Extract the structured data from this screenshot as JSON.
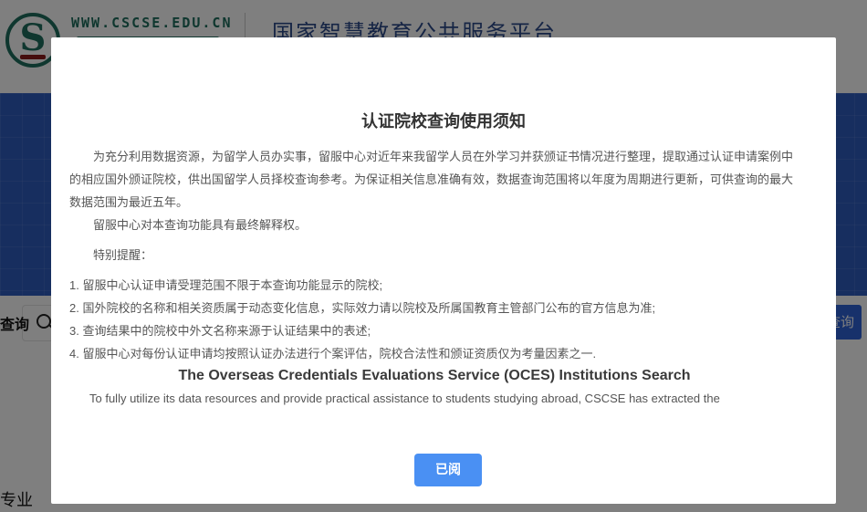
{
  "header": {
    "logo_url_text": "WWW.CSCSE.EDU.CN",
    "platform_title": "国家智慧教育公共服务平台"
  },
  "search": {
    "label": "查询",
    "button_label": "查询"
  },
  "background": {
    "bottom_label": "专业"
  },
  "modal": {
    "title": "认证院校查询使用须知",
    "paragraphs": [
      "为充分利用数据资源，为留学人员办实事，留服中心对近年来我留学人员在外学习并获颁证书情况进行整理，提取通过认证申请案例中的相应国外颁证院校，供出国留学人员择校查询参考。为保证相关信息准确有效，数据查询范围将以年度为周期进行更新，可供查询的最大数据范围为最近五年。",
      "留服中心对本查询功能具有最终解释权。"
    ],
    "reminder_heading": "特别提醒：",
    "reminders": [
      "1. 留服中心认证申请受理范围不限于本查询功能显示的院校;",
      "2. 国外院校的名称和相关资质属于动态变化信息，实际效力请以院校及所属国教育主管部门公布的官方信息为准;",
      "3. 查询结果中的院校中外文名称来源于认证结果中的表述;",
      "4. 留服中心对每份认证申请均按照认证办法进行个案评估，院校合法性和颁证资质仅为考量因素之一."
    ],
    "english_title": "The Overseas Credentials Evaluations Service (OCES) Institutions Search",
    "english_paragraph": "To fully utilize its data resources and provide practical assistance to students studying abroad, CSCSE has extracted the",
    "confirm_button": "已阅"
  },
  "colors": {
    "banner": "#2e5cbf",
    "confirm_button": "#4a90f3",
    "search_button": "#2f62d6",
    "logo_green": "#1f6f5e"
  }
}
